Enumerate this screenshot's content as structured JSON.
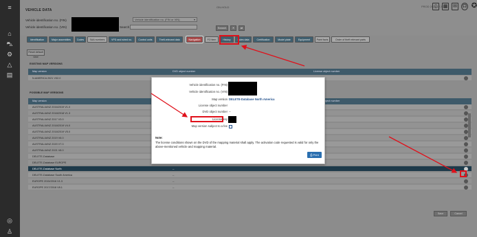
{
  "app": {
    "title": "Vehicle data",
    "center_caption": "ON-HOLD",
    "version": "PROD 2021 12.3.1-0"
  },
  "header": {
    "fin_label": "Vehicle identification no. (FIN)",
    "vin_label": "Vehicle identification no. (VIN)",
    "search_label": "Search",
    "select_value": "Vehicle identification no. (FIN or VIN)",
    "search_button": "Search"
  },
  "tabs": [
    {
      "label": "Identification"
    },
    {
      "label": "Major assemblies"
    },
    {
      "label": "Codes"
    },
    {
      "label": "SAA numbers"
    },
    {
      "label": "VPD and wired no."
    },
    {
      "label": "Control units"
    },
    {
      "label": "Theft-relevant data"
    },
    {
      "label": "Navigation"
    },
    {
      "label": "FO item"
    },
    {
      "label": "History"
    },
    {
      "label": "Sales data"
    },
    {
      "label": "Certification"
    },
    {
      "label": "Model plate"
    },
    {
      "label": "Equipment"
    },
    {
      "label": "Paint facts"
    },
    {
      "label": "Order of theft relevant parts"
    }
  ],
  "reset_button": "Reset default view",
  "existing": {
    "section_title": "Existing map versions",
    "columns": [
      "Map version",
      "DVD object number",
      "License object number"
    ],
    "rows": [
      {
        "map": "N.AMERICA 2021 V32.0",
        "dvd": "",
        "lic": ""
      }
    ]
  },
  "possible": {
    "section_title": "Possible map versions",
    "columns": [
      "Map version",
      "",
      "License object number"
    ],
    "rows": [
      {
        "map": "AUSTRALIA/NZ 2016/2019 V1.0",
        "dvd": ""
      },
      {
        "map": "AUSTRALIA/NZ 2018/2018 V1.3",
        "dvd": ""
      },
      {
        "map": "AUSTRALIA/NZ 2017 V3.0",
        "dvd": ""
      },
      {
        "map": "AUSTRALIA/NZ 2018/2019 V4.0",
        "dvd": ""
      },
      {
        "map": "AUSTRALIA/NZ 2018/2019 V5.0",
        "dvd": ""
      },
      {
        "map": "AUSTRALIA/NZ 2019 V6.0",
        "dvd": ""
      },
      {
        "map": "AUSTRALIA/NZ 2020 V7.0",
        "dvd": ""
      },
      {
        "map": "AUSTRALIA/NZ 2021 V8.0",
        "dvd": ""
      },
      {
        "map": "DELETE-Database",
        "dvd": ""
      },
      {
        "map": "DELETE-Database EUROPE",
        "dvd": "--"
      },
      {
        "map": "DELETE-Database North",
        "dvd": "--"
      },
      {
        "map": "DELETE-Database South America",
        "dvd": "--"
      },
      {
        "map": "EUROPE 2015/2016 V1.3",
        "dvd": "--"
      },
      {
        "map": "EUROPE 2017/2018 V8.1",
        "dvd": "--"
      }
    ]
  },
  "bottom_buttons": [
    "Save",
    "Cancel"
  ],
  "modal": {
    "fin_label": "Vehicle identification no. (FIN)",
    "vin_label": "Vehicle identification no. (VIN)",
    "map_version_label": "Map version",
    "map_version_value": "DELETE-Database North America",
    "license_object_label": "License object number",
    "dvd_object_label": "DVD object number",
    "dvd_object_value": "--",
    "license_key_label": "License key",
    "fee_label": "Map version subject to a fee",
    "note_title": "Note:",
    "note_text": "The license conditions shown on the DVD of the mapping material shall apply. The activation code requested is valid for only the above-mentioned vehicle and mapping material.",
    "print_button": "Print"
  },
  "colors": {
    "highlight": "#e0101a",
    "accent": "#2a6fb0",
    "selected_row": "#1e3a4a"
  }
}
